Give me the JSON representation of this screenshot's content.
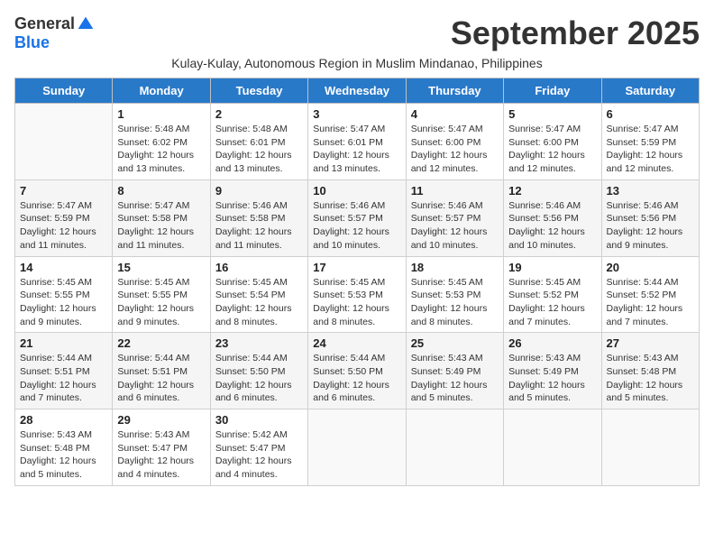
{
  "logo": {
    "general": "General",
    "blue": "Blue"
  },
  "title": "September 2025",
  "subtitle": "Kulay-Kulay, Autonomous Region in Muslim Mindanao, Philippines",
  "days_of_week": [
    "Sunday",
    "Monday",
    "Tuesday",
    "Wednesday",
    "Thursday",
    "Friday",
    "Saturday"
  ],
  "weeks": [
    [
      {
        "day": "",
        "info": ""
      },
      {
        "day": "1",
        "info": "Sunrise: 5:48 AM\nSunset: 6:02 PM\nDaylight: 12 hours\nand 13 minutes."
      },
      {
        "day": "2",
        "info": "Sunrise: 5:48 AM\nSunset: 6:01 PM\nDaylight: 12 hours\nand 13 minutes."
      },
      {
        "day": "3",
        "info": "Sunrise: 5:47 AM\nSunset: 6:01 PM\nDaylight: 12 hours\nand 13 minutes."
      },
      {
        "day": "4",
        "info": "Sunrise: 5:47 AM\nSunset: 6:00 PM\nDaylight: 12 hours\nand 12 minutes."
      },
      {
        "day": "5",
        "info": "Sunrise: 5:47 AM\nSunset: 6:00 PM\nDaylight: 12 hours\nand 12 minutes."
      },
      {
        "day": "6",
        "info": "Sunrise: 5:47 AM\nSunset: 5:59 PM\nDaylight: 12 hours\nand 12 minutes."
      }
    ],
    [
      {
        "day": "7",
        "info": "Sunrise: 5:47 AM\nSunset: 5:59 PM\nDaylight: 12 hours\nand 11 minutes."
      },
      {
        "day": "8",
        "info": "Sunrise: 5:47 AM\nSunset: 5:58 PM\nDaylight: 12 hours\nand 11 minutes."
      },
      {
        "day": "9",
        "info": "Sunrise: 5:46 AM\nSunset: 5:58 PM\nDaylight: 12 hours\nand 11 minutes."
      },
      {
        "day": "10",
        "info": "Sunrise: 5:46 AM\nSunset: 5:57 PM\nDaylight: 12 hours\nand 10 minutes."
      },
      {
        "day": "11",
        "info": "Sunrise: 5:46 AM\nSunset: 5:57 PM\nDaylight: 12 hours\nand 10 minutes."
      },
      {
        "day": "12",
        "info": "Sunrise: 5:46 AM\nSunset: 5:56 PM\nDaylight: 12 hours\nand 10 minutes."
      },
      {
        "day": "13",
        "info": "Sunrise: 5:46 AM\nSunset: 5:56 PM\nDaylight: 12 hours\nand 9 minutes."
      }
    ],
    [
      {
        "day": "14",
        "info": "Sunrise: 5:45 AM\nSunset: 5:55 PM\nDaylight: 12 hours\nand 9 minutes."
      },
      {
        "day": "15",
        "info": "Sunrise: 5:45 AM\nSunset: 5:55 PM\nDaylight: 12 hours\nand 9 minutes."
      },
      {
        "day": "16",
        "info": "Sunrise: 5:45 AM\nSunset: 5:54 PM\nDaylight: 12 hours\nand 8 minutes."
      },
      {
        "day": "17",
        "info": "Sunrise: 5:45 AM\nSunset: 5:53 PM\nDaylight: 12 hours\nand 8 minutes."
      },
      {
        "day": "18",
        "info": "Sunrise: 5:45 AM\nSunset: 5:53 PM\nDaylight: 12 hours\nand 8 minutes."
      },
      {
        "day": "19",
        "info": "Sunrise: 5:45 AM\nSunset: 5:52 PM\nDaylight: 12 hours\nand 7 minutes."
      },
      {
        "day": "20",
        "info": "Sunrise: 5:44 AM\nSunset: 5:52 PM\nDaylight: 12 hours\nand 7 minutes."
      }
    ],
    [
      {
        "day": "21",
        "info": "Sunrise: 5:44 AM\nSunset: 5:51 PM\nDaylight: 12 hours\nand 7 minutes."
      },
      {
        "day": "22",
        "info": "Sunrise: 5:44 AM\nSunset: 5:51 PM\nDaylight: 12 hours\nand 6 minutes."
      },
      {
        "day": "23",
        "info": "Sunrise: 5:44 AM\nSunset: 5:50 PM\nDaylight: 12 hours\nand 6 minutes."
      },
      {
        "day": "24",
        "info": "Sunrise: 5:44 AM\nSunset: 5:50 PM\nDaylight: 12 hours\nand 6 minutes."
      },
      {
        "day": "25",
        "info": "Sunrise: 5:43 AM\nSunset: 5:49 PM\nDaylight: 12 hours\nand 5 minutes."
      },
      {
        "day": "26",
        "info": "Sunrise: 5:43 AM\nSunset: 5:49 PM\nDaylight: 12 hours\nand 5 minutes."
      },
      {
        "day": "27",
        "info": "Sunrise: 5:43 AM\nSunset: 5:48 PM\nDaylight: 12 hours\nand 5 minutes."
      }
    ],
    [
      {
        "day": "28",
        "info": "Sunrise: 5:43 AM\nSunset: 5:48 PM\nDaylight: 12 hours\nand 5 minutes."
      },
      {
        "day": "29",
        "info": "Sunrise: 5:43 AM\nSunset: 5:47 PM\nDaylight: 12 hours\nand 4 minutes."
      },
      {
        "day": "30",
        "info": "Sunrise: 5:42 AM\nSunset: 5:47 PM\nDaylight: 12 hours\nand 4 minutes."
      },
      {
        "day": "",
        "info": ""
      },
      {
        "day": "",
        "info": ""
      },
      {
        "day": "",
        "info": ""
      },
      {
        "day": "",
        "info": ""
      }
    ]
  ]
}
